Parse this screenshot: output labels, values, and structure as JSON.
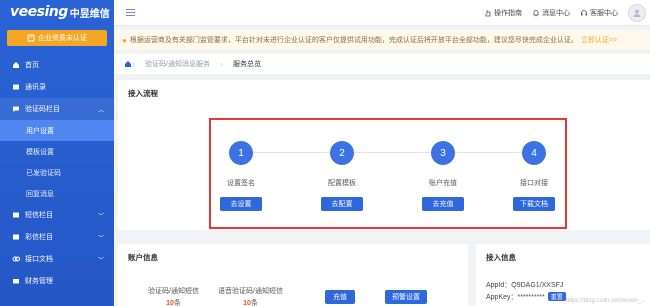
{
  "sidebar": {
    "logo_brand": "veesing",
    "logo_brand_cn": "中昱维信",
    "cert_button": "企业资质未认证",
    "items": [
      {
        "label": "首页"
      },
      {
        "label": "通讯录"
      },
      {
        "label": "验证码栏目"
      },
      {
        "label": "短信栏目"
      },
      {
        "label": "彩信栏目"
      },
      {
        "label": "接口文档"
      },
      {
        "label": "财务管理"
      }
    ],
    "subitems": [
      {
        "label": "用户设置"
      },
      {
        "label": "模板设置"
      },
      {
        "label": "已发验证码"
      },
      {
        "label": "回复消息"
      }
    ]
  },
  "topbar": {
    "guide": "操作指南",
    "messages": "消息中心",
    "service": "客服中心"
  },
  "notice": {
    "text": "根据运营商及有关部门监管要求，平台针对未进行企业认证的客户仅提供试用功能，完成认证后将开放平台全部功能，建议您尽快完成企业认证。",
    "link": "立即认证>>"
  },
  "breadcrumb": {
    "parent": "验证码/通知消息服务",
    "current": "服务总览"
  },
  "flow": {
    "title": "接入流程",
    "steps": [
      {
        "num": "1",
        "label": "设置签名",
        "button": "去设置"
      },
      {
        "num": "2",
        "label": "配置模板",
        "button": "去配置"
      },
      {
        "num": "3",
        "label": "账户充值",
        "button": "去充值"
      },
      {
        "num": "4",
        "label": "接口对接",
        "button": "下载文档"
      }
    ]
  },
  "account": {
    "title": "账户信息",
    "verify_label": "验证码/通知短信",
    "verify_count": "10",
    "verify_unit": "条",
    "voice_label": "语音验证码/通知短信",
    "voice_count": "10",
    "voice_unit": "条",
    "recharge_button": "充值",
    "warning_button": "预警设置"
  },
  "access": {
    "title": "接入信息",
    "appid": "AppId：Q9DAG1/XXSFJ",
    "appkey": "AppKey：**********",
    "reset_button": "重置",
    "watermark": "https://blog.csdn.net/weixin_..."
  },
  "colors": {
    "sidebar": "#2a63d6",
    "primary": "#2f67dd",
    "highlight_box": "#e53935",
    "warning": "#f5a623"
  }
}
